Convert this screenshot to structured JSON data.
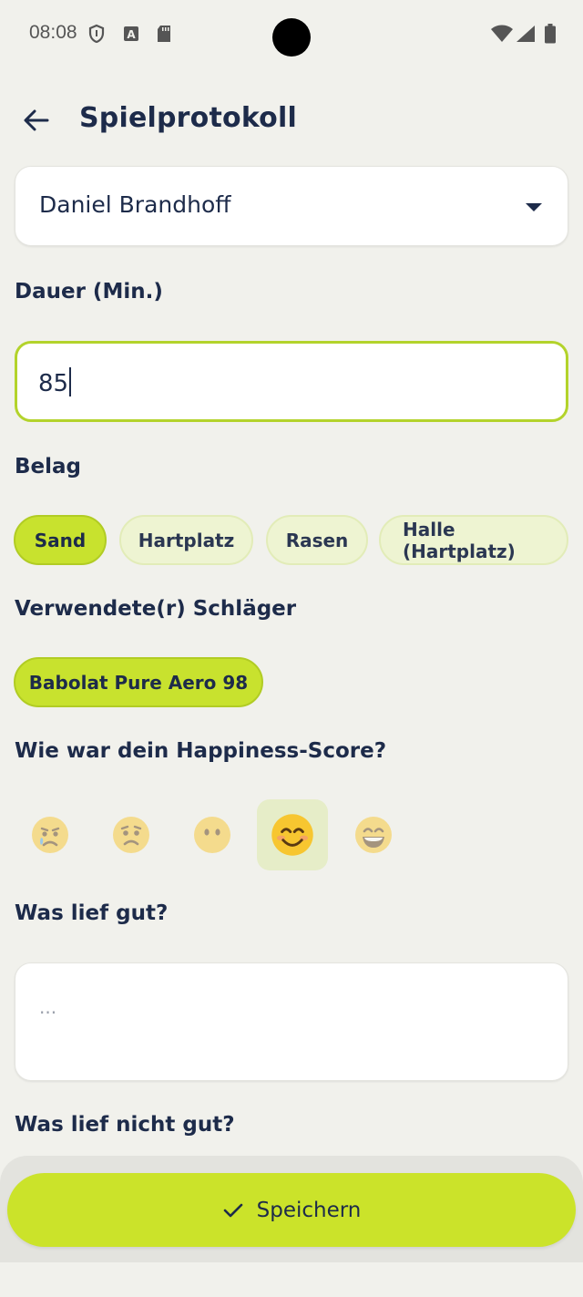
{
  "status_bar": {
    "time": "08:08",
    "icons": [
      "shield-icon",
      "a-keyboard-icon",
      "sd-card-icon",
      "wifi-icon",
      "signal-icon",
      "battery-icon"
    ]
  },
  "app_bar": {
    "back_icon": "arrow-left-icon",
    "title": "Spielprotokoll"
  },
  "player_select": {
    "value": "Daniel Brandhoff"
  },
  "duration": {
    "label": "Dauer (Min.)",
    "value": "85"
  },
  "surface": {
    "label": "Belag",
    "options": [
      {
        "label": "Sand",
        "selected": true
      },
      {
        "label": "Hartplatz",
        "selected": false
      },
      {
        "label": "Rasen",
        "selected": false
      },
      {
        "label": "Halle (Hartplatz)",
        "selected": false
      }
    ]
  },
  "racket": {
    "label": "Verwendete(r) Schläger",
    "options": [
      {
        "label": "Babolat Pure Aero 98",
        "selected": true
      }
    ]
  },
  "happiness": {
    "label": "Wie war dein Happiness-Score?",
    "options": [
      {
        "icon": "crying-face-icon",
        "selected": false
      },
      {
        "icon": "worried-face-icon",
        "selected": false
      },
      {
        "icon": "neutral-face-icon",
        "selected": false
      },
      {
        "icon": "smiling-face-icon",
        "selected": true
      },
      {
        "icon": "grinning-face-icon",
        "selected": false
      }
    ]
  },
  "went_well": {
    "label": "Was lief gut?",
    "placeholder": "..."
  },
  "went_badly": {
    "label": "Was lief nicht gut?"
  },
  "save_button": {
    "icon": "check-icon",
    "label": "Speichern"
  },
  "colors": {
    "accent": "#c8e22e",
    "accent_light": "#eef4d2",
    "text": "#1d2b4a",
    "background": "#f1f1ec"
  }
}
